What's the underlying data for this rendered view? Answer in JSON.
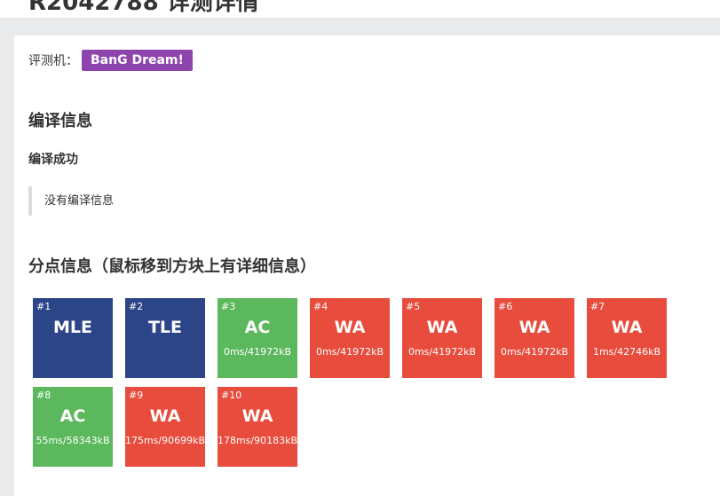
{
  "page": {
    "title": "R2042788 详测详情"
  },
  "judger": {
    "label": "评测机：",
    "name": "BanG Dream!"
  },
  "compile": {
    "section_title": "编译信息",
    "status": "编译成功",
    "message": "没有编译信息"
  },
  "subtasks": {
    "section_title": "分点信息（鼠标移到方块上有详细信息）",
    "tests": [
      {
        "id": "#1",
        "status": "MLE",
        "stat": "",
        "color": "#2c4488"
      },
      {
        "id": "#2",
        "status": "TLE",
        "stat": "",
        "color": "#2c4488"
      },
      {
        "id": "#3",
        "status": "AC",
        "stat": "0ms/41972kB",
        "color": "#5cb85c"
      },
      {
        "id": "#4",
        "status": "WA",
        "stat": "0ms/41972kB",
        "color": "#e74c3c"
      },
      {
        "id": "#5",
        "status": "WA",
        "stat": "0ms/41972kB",
        "color": "#e74c3c"
      },
      {
        "id": "#6",
        "status": "WA",
        "stat": "0ms/41972kB",
        "color": "#e74c3c"
      },
      {
        "id": "#7",
        "status": "WA",
        "stat": "1ms/42746kB",
        "color": "#e74c3c"
      },
      {
        "id": "#8",
        "status": "AC",
        "stat": "55ms/58343kB",
        "color": "#5cb85c"
      },
      {
        "id": "#9",
        "status": "WA",
        "stat": "175ms/90699kB",
        "color": "#e74c3c"
      },
      {
        "id": "#10",
        "status": "WA",
        "stat": "178ms/90183kB",
        "color": "#e74c3c"
      }
    ]
  }
}
